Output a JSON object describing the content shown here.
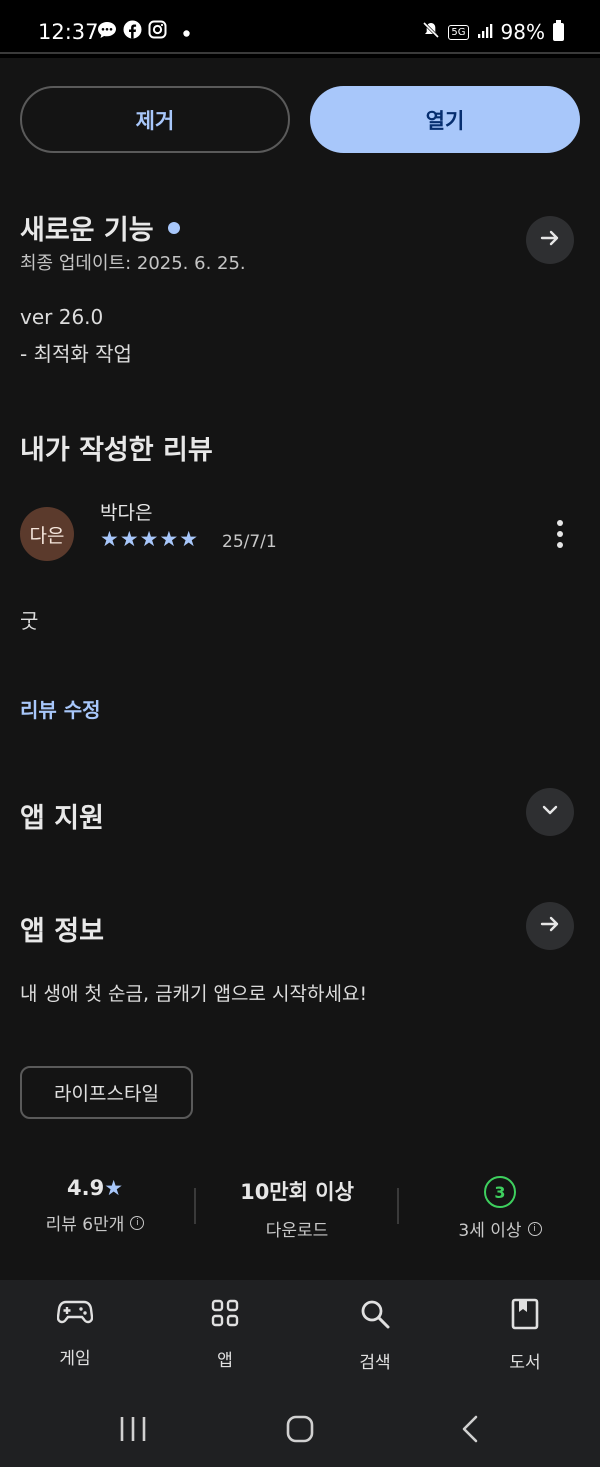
{
  "status_bar": {
    "time": "12:37",
    "battery": "98%",
    "network": "5G",
    "left_icons": [
      "chat-icon",
      "facebook-icon",
      "instagram-icon",
      "dot-icon"
    ],
    "right_icons": [
      "mute-icon",
      "5g-icon",
      "signal-icon",
      "battery-icon"
    ]
  },
  "actions": {
    "remove_label": "제거",
    "open_label": "열기"
  },
  "whats_new": {
    "title": "새로운 기능",
    "updated": "최종 업데이트: 2025. 6. 25.",
    "version": "ver 26.0",
    "notes": "- 최적화 작업"
  },
  "my_review": {
    "title": "내가 작성한 리뷰",
    "avatar_text": "다은",
    "author": "박다은",
    "rating": 5,
    "stars": "★★★★★",
    "date": "25/7/1",
    "text": "굿",
    "edit_label": "리뷰 수정"
  },
  "app_support": {
    "title": "앱 지원"
  },
  "app_info": {
    "title": "앱 정보",
    "description": "내 생애 첫 순금, 금캐기 앱으로 시작하세요!",
    "category": "라이프스타일"
  },
  "stats": {
    "rating_value": "4.9",
    "rating_star": "★",
    "reviews": "리뷰 6만개",
    "downloads_value": "10만회 이상",
    "downloads_label": "다운로드",
    "age_badge": "3",
    "age_label": "3세 이상"
  },
  "bottom_nav": {
    "items": [
      {
        "label": "게임",
        "icon": "gamepad-icon"
      },
      {
        "label": "앱",
        "icon": "apps-grid-icon"
      },
      {
        "label": "검색",
        "icon": "search-icon"
      },
      {
        "label": "도서",
        "icon": "book-icon"
      }
    ]
  },
  "colors": {
    "accent": "#a8c7fa",
    "background": "#141414",
    "age_green": "#3ecf5e"
  }
}
